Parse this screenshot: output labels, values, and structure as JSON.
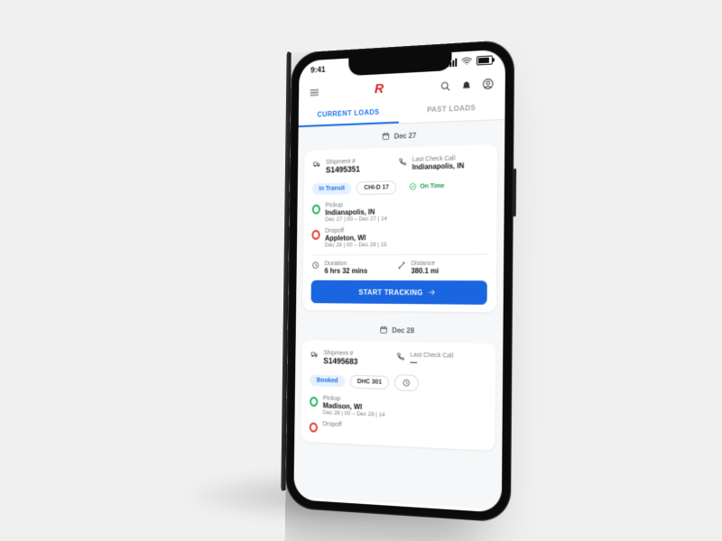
{
  "statusbar": {
    "time": "9:41"
  },
  "tabs": {
    "current": "CURRENT LOADS",
    "past": "PAST LOADS"
  },
  "groups": [
    {
      "date": "Dec 27",
      "card": {
        "shipment_lbl": "Shipment #",
        "shipment": "S1495351",
        "lastcall_lbl": "Last Check Call",
        "lastcall": "Indianapolis, IN",
        "status": "In Transit",
        "ref": "CHI-D 17",
        "timing": "On Time",
        "pickup_lbl": "Pickup",
        "pickup_city": "Indianapolis, IN",
        "pickup_window": "Dec 27 | 00 – Dec 27 | 14",
        "dropoff_lbl": "Dropoff",
        "dropoff_city": "Appleton, WI",
        "dropoff_window": "Dec 28 | 00 – Dec 28 | 15",
        "duration_lbl": "Duration",
        "duration": "6 hrs 32 mins",
        "distance_lbl": "Distance",
        "distance": "380.1 mi",
        "cta": "START TRACKING"
      }
    },
    {
      "date": "Dec 28",
      "card": {
        "shipment_lbl": "Shipment #",
        "shipment": "S1495683",
        "lastcall_lbl": "Last Check Call",
        "lastcall": "—",
        "status": "Booked",
        "ref": "DHC 301",
        "timing": "",
        "pickup_lbl": "Pickup",
        "pickup_city": "Madison, WI",
        "pickup_window": "Dec 28 | 00 – Dec 28 | 14",
        "dropoff_lbl": "Dropoff"
      }
    }
  ]
}
